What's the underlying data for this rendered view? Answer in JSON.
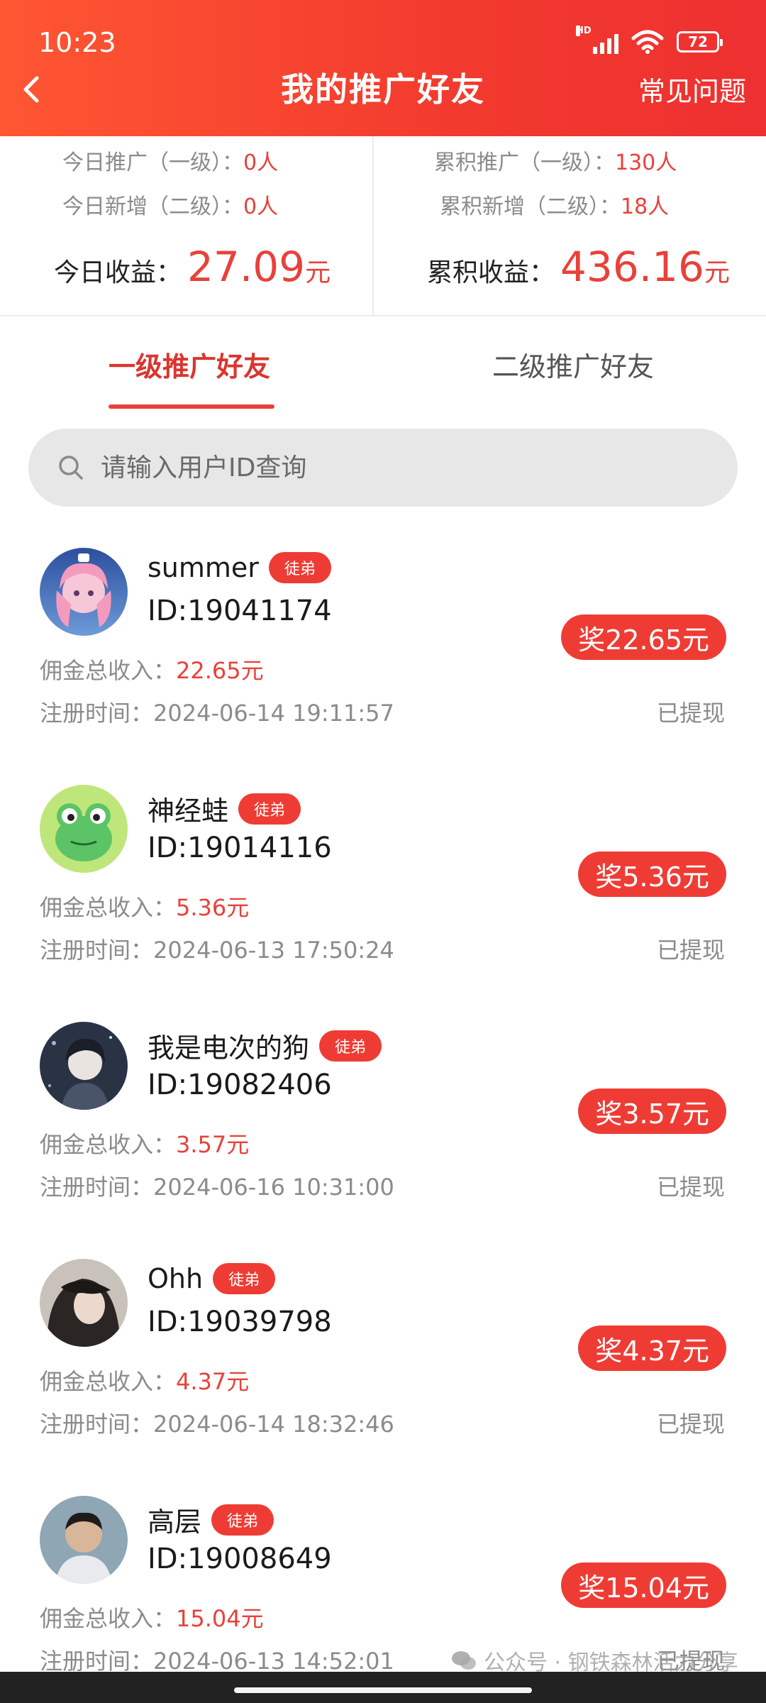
{
  "status_bar": {
    "time": "10:23",
    "network_label": "HD",
    "battery": "72"
  },
  "header": {
    "title": "我的推广好友",
    "faq": "常见问题"
  },
  "stats": {
    "left": {
      "line1_label": "今日推广（一级）：",
      "line1_value": "0人",
      "line2_label": "今日新增（二级）：",
      "line2_value": "0人",
      "earn_label": "今日收益：",
      "earn_value": "27.09",
      "earn_unit": "元"
    },
    "right": {
      "line1_label": "累积推广（一级）：",
      "line1_value": "130人",
      "line2_label": "累积新增（二级）：",
      "line2_value": "18人",
      "earn_label": "累积收益：",
      "earn_value": "436.16",
      "earn_unit": "元"
    }
  },
  "tabs": [
    {
      "label": "一级推广好友",
      "active": true
    },
    {
      "label": "二级推广好友",
      "active": false
    }
  ],
  "search": {
    "placeholder": "请输入用户ID查询"
  },
  "friends": [
    {
      "name": "summer",
      "badge": "徒弟",
      "id": "ID:19041174",
      "reward": "奖22.65元",
      "commission_label": "佣金总收入：",
      "commission": "22.65元",
      "reg_label": "注册时间：",
      "reg_time": "2024-06-14 19:11:57",
      "status": "已提现"
    },
    {
      "name": "神经蛙",
      "badge": "徒弟",
      "id": "ID:19014116",
      "reward": "奖5.36元",
      "commission_label": "佣金总收入：",
      "commission": "5.36元",
      "reg_label": "注册时间：",
      "reg_time": "2024-06-13 17:50:24",
      "status": "已提现"
    },
    {
      "name": "我是电次的狗",
      "badge": "徒弟",
      "id": "ID:19082406",
      "reward": "奖3.57元",
      "commission_label": "佣金总收入：",
      "commission": "3.57元",
      "reg_label": "注册时间：",
      "reg_time": "2024-06-16 10:31:00",
      "status": "已提现"
    },
    {
      "name": "Ohh",
      "badge": "徒弟",
      "id": "ID:19039798",
      "reward": "奖4.37元",
      "commission_label": "佣金总收入：",
      "commission": "4.37元",
      "reg_label": "注册时间：",
      "reg_time": "2024-06-14 18:32:46",
      "status": "已提现"
    },
    {
      "name": "高层",
      "badge": "徒弟",
      "id": "ID:19008649",
      "reward": "奖15.04元",
      "commission_label": "佣金总收入：",
      "commission": "15.04元",
      "reg_label": "注册时间：",
      "reg_time": "2024-06-13 14:52:01",
      "status": "已提现"
    }
  ],
  "watermark": "公众号 · 钢铁森林活力分享",
  "colors": {
    "header_start": "#ff5633",
    "header_end": "#ee3030",
    "accent_red": "#e8413a",
    "muted_text": "#8b8b8b"
  }
}
